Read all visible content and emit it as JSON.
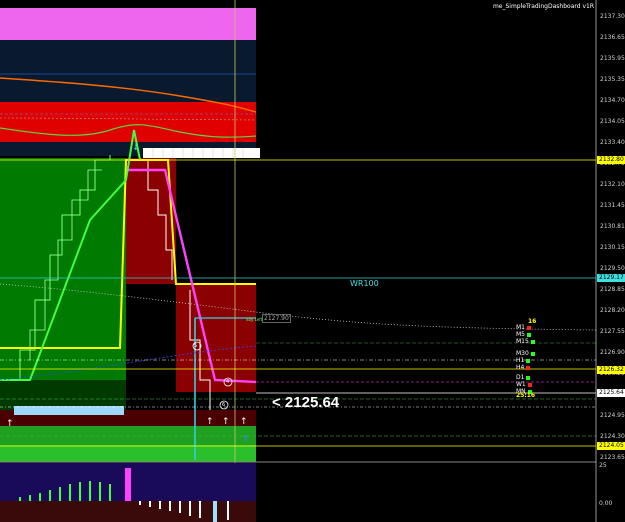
{
  "window": {
    "title": "me_SimpleTradingDashboard v1R"
  },
  "price_axis": {
    "labels": [
      "2137.30",
      "2136.65",
      "2135.95",
      "2135.35",
      "2134.70",
      "2134.05",
      "2133.40",
      "2132.75",
      "2132.10",
      "2131.45",
      "2130.81",
      "2130.15",
      "2129.50",
      "2128.85",
      "2128.20",
      "2127.55",
      "2126.90",
      "2126.25",
      "2125.60",
      "2124.95",
      "2124.30",
      "2123.65"
    ],
    "tags": [
      {
        "text": "2132.80",
        "bg": "#ffff00",
        "fg": "#000000"
      },
      {
        "text": "2129.17",
        "bg": "#40e0e0",
        "fg": "#000000"
      },
      {
        "text": "2126.32",
        "bg": "#ffff00",
        "fg": "#000000"
      },
      {
        "text": "2125.64",
        "bg": "#ffffff",
        "fg": "#000000"
      },
      {
        "text": "2124.05",
        "bg": "#ffff00",
        "fg": "#000000"
      }
    ]
  },
  "indicator_axis": {
    "top": "25",
    "bottom": "0.00"
  },
  "current_price": "<  2125.64",
  "wr_label": "WR100",
  "level_label": "2127.90",
  "small_label": "Say Left",
  "dashboard": {
    "count_label": "16",
    "timer": "25:16",
    "rows": [
      {
        "tf": "M1",
        "color": "#ff2020"
      },
      {
        "tf": "M5",
        "color": "#20ff20"
      },
      {
        "tf": "M15",
        "color": "#20ff20"
      },
      {
        "tf": "M30",
        "color": "#20ff20"
      },
      {
        "tf": "H1",
        "color": "#20ff20"
      },
      {
        "tf": "H4",
        "color": "#ff2020"
      },
      {
        "tf": "D1",
        "color": "#20ff20"
      },
      {
        "tf": "W1",
        "color": "#ff2020"
      },
      {
        "tf": "MN",
        "color": "#20ff20"
      }
    ]
  },
  "circle_markers": [
    "5",
    "4",
    "6"
  ],
  "colors": {
    "background": "#000000",
    "magenta": "#ff60ff",
    "red_zone": "#ff0000",
    "dark_red": "#8b0000",
    "green_zone": "#008000",
    "yellow": "#ffff00",
    "cyan": "#40e0e0",
    "lime": "#32cd32"
  }
}
